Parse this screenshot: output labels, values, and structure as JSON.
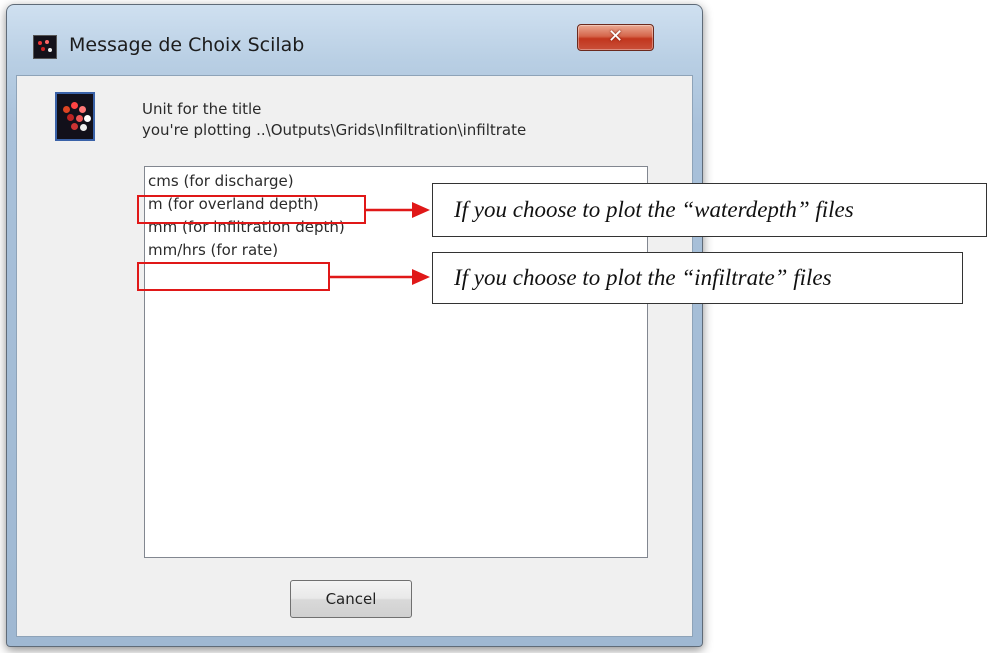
{
  "window": {
    "title": "Message de Choix Scilab",
    "close_label": "✕"
  },
  "message": {
    "line1": "Unit for the title",
    "line2": "you're plotting ..\\Outputs\\Grids\\Infiltration\\infiltrate"
  },
  "list": {
    "items": [
      "cms (for discharge)",
      "m (for overland depth)",
      "mm (for infiltration depth)",
      "mm/hrs (for rate)"
    ]
  },
  "buttons": {
    "cancel_label": "Cancel"
  },
  "annotations": {
    "waterdepth": "If you choose to plot the “waterdepth” files",
    "infiltrate": "If you choose to plot the “infiltrate” files",
    "color": "#e01818"
  },
  "icons": {
    "app": "scilab-app-icon",
    "message": "scilab-logo-icon",
    "close": "close-icon"
  }
}
